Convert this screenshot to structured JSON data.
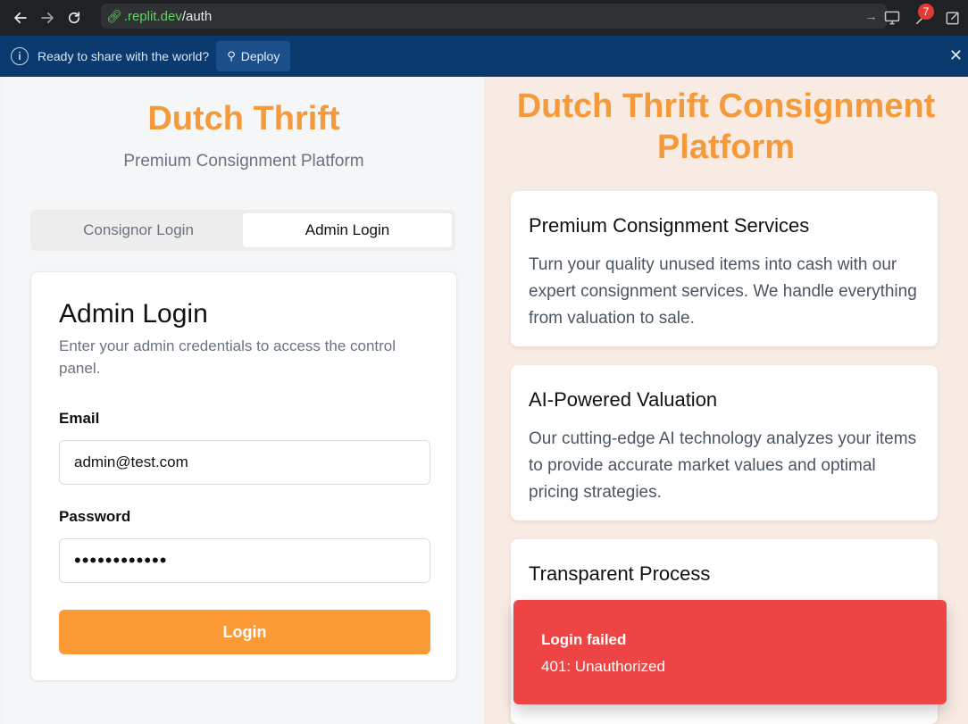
{
  "browser": {
    "url_domain": ".replit.dev",
    "url_path": "/auth",
    "extension_badge": "7"
  },
  "banner": {
    "message": "Ready to share with the world?",
    "deploy_label": "Deploy",
    "close_label": "✕"
  },
  "left": {
    "brand": "Dutch Thrift",
    "tagline": "Premium Consignment Platform",
    "tabs": [
      {
        "label": "Consignor Login",
        "active": false
      },
      {
        "label": "Admin Login",
        "active": true
      }
    ],
    "card": {
      "title": "Admin Login",
      "description": "Enter your admin credentials to access the control panel.",
      "email_label": "Email",
      "email_value": "admin@test.com",
      "password_label": "Password",
      "password_value": "••••••••••••",
      "login_button": "Login"
    }
  },
  "right": {
    "title": "Dutch Thrift Consignment Platform",
    "features": [
      {
        "title": "Premium Consignment Services",
        "text": "Turn your quality unused items into cash with our expert consignment services. We handle everything from valuation to sale."
      },
      {
        "title": "AI-Powered Valuation",
        "text": "Our cutting-edge AI technology analyzes your items to provide accurate market values and optimal pricing strategies."
      },
      {
        "title": "Transparent Process",
        "text": ""
      }
    ]
  },
  "toast": {
    "title": "Login failed",
    "message": "401: Unauthorized",
    "color": "#ef4444"
  }
}
